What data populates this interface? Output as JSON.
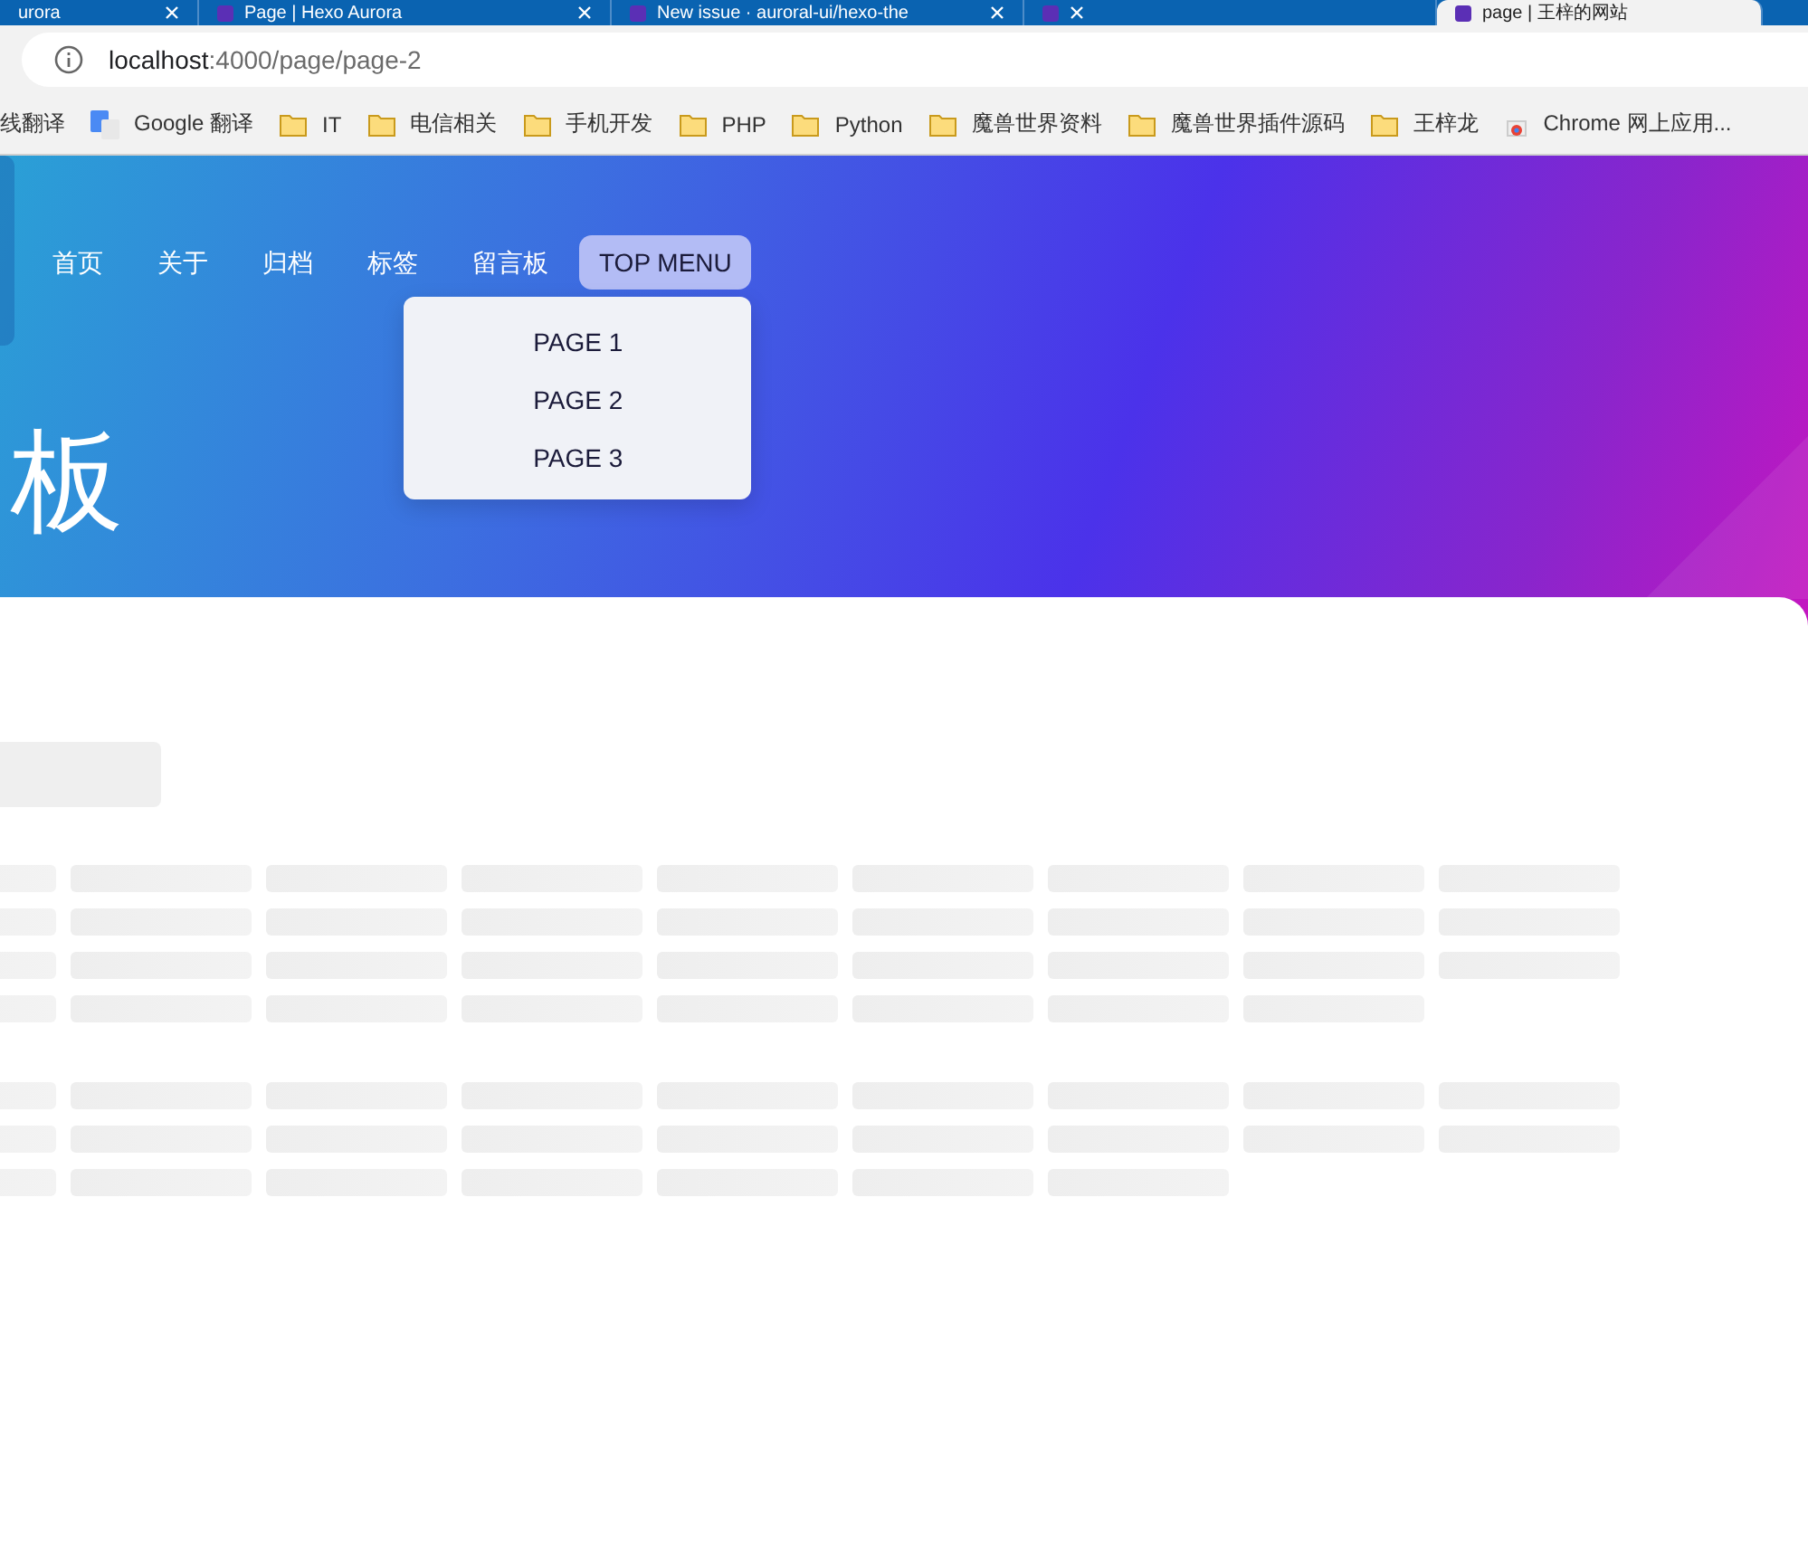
{
  "tabs": [
    {
      "title": "urora",
      "selected": false
    },
    {
      "title": "Page | Hexo Aurora",
      "selected": false
    },
    {
      "title": "New issue · auroral-ui/hexo-the",
      "selected": false
    },
    {
      "selected": false
    },
    {
      "title": "page | 王梓的网站",
      "selected": true
    }
  ],
  "address": {
    "host": "localhost",
    "path": ":4000/page/page-2"
  },
  "bookmarks": [
    {
      "label": "线翻译",
      "kind": "plain"
    },
    {
      "label": "Google 翻译",
      "kind": "google"
    },
    {
      "label": "IT",
      "kind": "folder"
    },
    {
      "label": "电信相关",
      "kind": "folder"
    },
    {
      "label": "手机开发",
      "kind": "folder"
    },
    {
      "label": "PHP",
      "kind": "folder"
    },
    {
      "label": "Python",
      "kind": "folder"
    },
    {
      "label": "魔兽世界资料",
      "kind": "folder"
    },
    {
      "label": "魔兽世界插件源码",
      "kind": "folder"
    },
    {
      "label": "王梓龙",
      "kind": "folder"
    },
    {
      "label": "Chrome 网上应用...",
      "kind": "store"
    }
  ],
  "nav": [
    {
      "label": "首页",
      "selected": false
    },
    {
      "label": "关于",
      "selected": false
    },
    {
      "label": "归档",
      "selected": false
    },
    {
      "label": "标签",
      "selected": false
    },
    {
      "label": "留言板",
      "selected": false
    },
    {
      "label": "TOP MENU",
      "selected": true
    }
  ],
  "dropdown": [
    "PAGE 1",
    "PAGE 2",
    "PAGE 3"
  ],
  "hero_title": "板"
}
